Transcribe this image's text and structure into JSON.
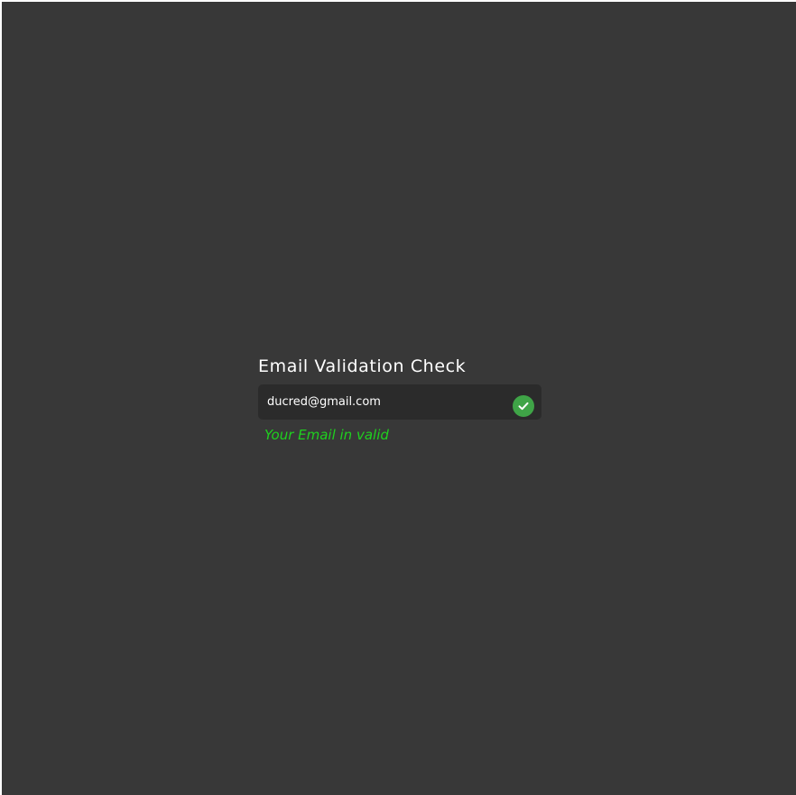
{
  "form": {
    "title": "Email Validation Check",
    "email_value": "ducred@gmail.com",
    "status_message": "Your Email in valid",
    "status_icon": "check-circle-icon"
  },
  "colors": {
    "background": "#383838",
    "field": "#2b2b2b",
    "valid_icon": "#3fa447",
    "valid_text": "#1fd11f"
  }
}
